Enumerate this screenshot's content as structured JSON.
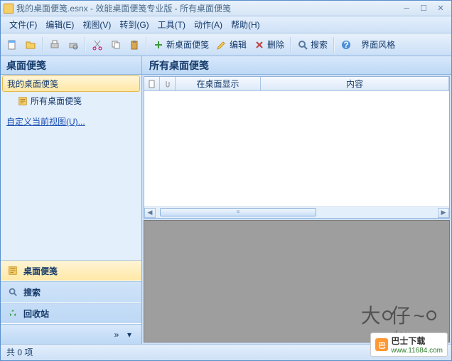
{
  "title": "我的桌面便笺.esnx - 效能桌面便笺专业版 - 所有桌面便笺",
  "menu": [
    "文件(F)",
    "编辑(E)",
    "视图(V)",
    "转到(G)",
    "工具(T)",
    "动作(A)",
    "帮助(H)"
  ],
  "toolbar": {
    "new_note": "新桌面便笺",
    "edit": "编辑",
    "delete": "删除",
    "search": "搜索",
    "theme": "界面风格"
  },
  "sidebar": {
    "panel_title": "桌面便笺",
    "tree_root": "我的桌面便笺",
    "tree_child": "所有桌面便笺",
    "customize": "自定义当前视图(U)...",
    "nav": [
      {
        "label": "桌面便笺",
        "icon": "note"
      },
      {
        "label": "搜索",
        "icon": "search"
      },
      {
        "label": "回收站",
        "icon": "recycle"
      }
    ]
  },
  "main": {
    "title": "所有桌面便笺",
    "columns": [
      "",
      "",
      "在桌面显示",
      "内容"
    ]
  },
  "status": "共 0 项",
  "download": {
    "site": "巴士下载",
    "url": "www.11684.com"
  },
  "watermark": {
    "big": "大眼仔~旭",
    "small": "day"
  }
}
